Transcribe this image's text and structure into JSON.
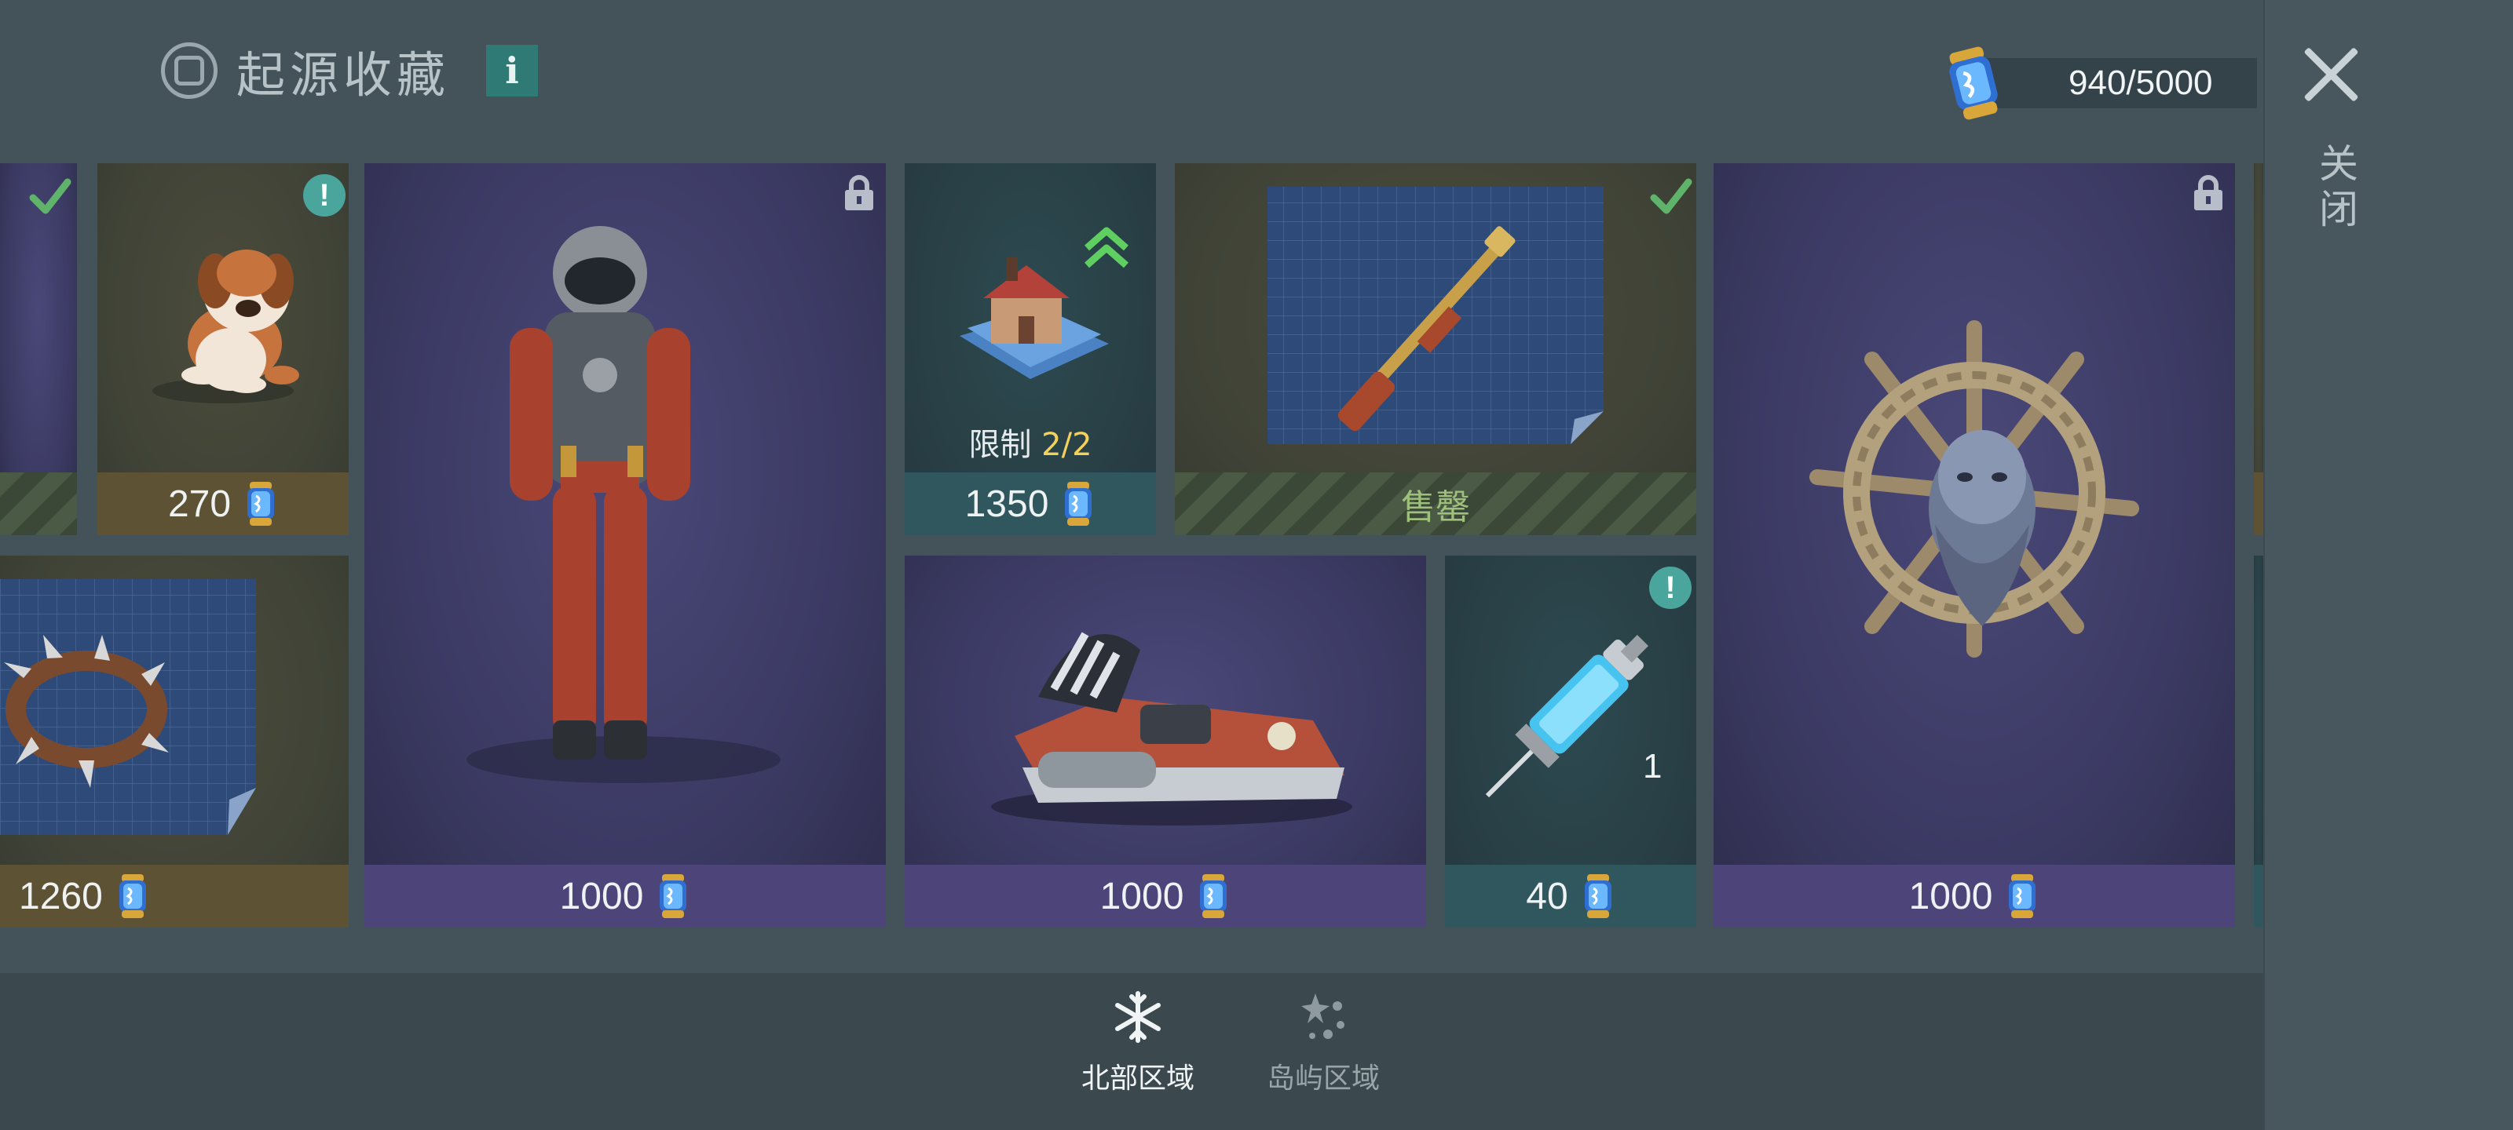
{
  "header": {
    "title": "起源收藏",
    "info_label": "i"
  },
  "currency": {
    "amount": "940/5000",
    "icon": "token-capsule-icon"
  },
  "close": {
    "label": "关闭"
  },
  "cards": {
    "partial_left_top": {
      "status": "owned"
    },
    "dog": {
      "price": "270",
      "badge": "!"
    },
    "suit": {
      "price": "1000",
      "status": "locked"
    },
    "house": {
      "limit_label": "限制",
      "limit_value": "2/2",
      "price": "1350",
      "badge": "upgrade"
    },
    "rifle": {
      "status_text": "售罄",
      "status": "owned"
    },
    "collar": {
      "price": "1260"
    },
    "hoverbike": {
      "price": "1000"
    },
    "syringe": {
      "price": "40",
      "quantity": "1",
      "badge": "!"
    },
    "wheel": {
      "price": "1000",
      "status": "locked"
    }
  },
  "tabs": [
    {
      "label": "北部区域",
      "icon": "snowflake-icon",
      "active": true
    },
    {
      "label": "岛屿区域",
      "icon": "sparkle-cluster-icon",
      "active": false
    }
  ],
  "colors": {
    "accent_teal": "#2f7a74",
    "gold": "#f3d15a",
    "sold_green": "#9fc07a"
  }
}
